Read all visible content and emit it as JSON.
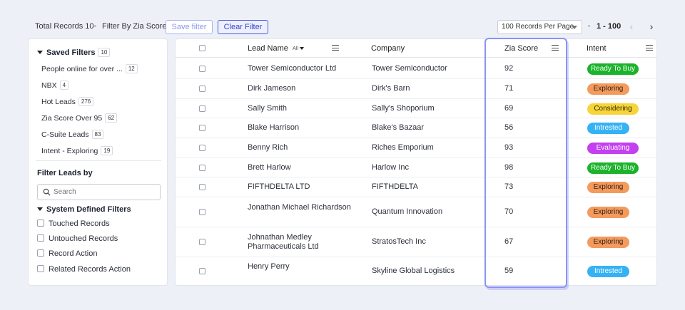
{
  "toolbar": {
    "total_records": "Total Records 10",
    "filter_by": "Filter By Zia Score",
    "save_filter": "Save filter",
    "clear_filter": "Clear Filter",
    "per_page": "100 Records Per Page",
    "page_range": "1 - 100",
    "prev_glyph": "‹",
    "next_glyph": "›"
  },
  "sidebar": {
    "saved_filters": {
      "label": "Saved Filters",
      "count": "10"
    },
    "saved_items": [
      {
        "label": "People online for over ...",
        "count": "12"
      },
      {
        "label": "NBX",
        "count": "4"
      },
      {
        "label": "Hot Leads",
        "count": "276"
      },
      {
        "label": "Zia Score Over 95",
        "count": "62"
      },
      {
        "label": "C-Suite Leads",
        "count": "83"
      },
      {
        "label": "Intent - Exploring",
        "count": "19"
      }
    ],
    "filter_leads_by": "Filter Leads by",
    "search_placeholder": "Search",
    "system_defined": "System Defined Filters",
    "system_items": [
      "Touched Records",
      "Untouched Records",
      "Record Action",
      "Related Records Action"
    ]
  },
  "table": {
    "headers": {
      "lead_name": "Lead Name",
      "all_tag": "All",
      "company": "Company",
      "zia_score": "Zia Score",
      "intent": "Intent"
    },
    "rows": [
      {
        "lead": "Tower Semiconductor Ltd",
        "company": "Tower Semiconductor",
        "score": "92",
        "intent": "Ready To Buy"
      },
      {
        "lead": "Dirk Jameson",
        "company": "Dirk's Barn",
        "score": "71",
        "intent": "Exploring"
      },
      {
        "lead": "Sally Smith",
        "company": "Sally's Shoporium",
        "score": "69",
        "intent": "Considering"
      },
      {
        "lead": "Blake Harrison",
        "company": "Blake's Bazaar",
        "score": "56",
        "intent": "Intrested"
      },
      {
        "lead": "Benny Rich",
        "company": "Riches Emporium",
        "score": "93",
        "intent": "Evaluating"
      },
      {
        "lead": "Brett Harlow",
        "company": "Harlow Inc",
        "score": "98",
        "intent": "Ready To Buy"
      },
      {
        "lead": "FIFTHDELTA LTD",
        "company": "FIFTHDELTA",
        "score": "73",
        "intent": "Exploring"
      },
      {
        "lead": "Jonathan Michael Richardson",
        "company": "Quantum Innovation",
        "score": "70",
        "intent": "Exploring"
      },
      {
        "lead": "Johnathan Medley Pharmaceuticals Ltd",
        "company": "StratosTech Inc",
        "score": "67",
        "intent": "Exploring"
      },
      {
        "lead": "Henry Perry",
        "company": "Skyline Global Logistics",
        "score": "59",
        "intent": "Intrested"
      }
    ]
  },
  "intent_colors": {
    "Ready To Buy": {
      "bg": "#1bb32a",
      "fg": "#ffffff"
    },
    "Exploring": {
      "bg": "#f39a5d",
      "fg": "#3a2212"
    },
    "Considering": {
      "bg": "#f6d43a",
      "fg": "#3a3000"
    },
    "Intrested": {
      "bg": "#35b2f4",
      "fg": "#ffffff"
    },
    "Evaluating": {
      "bg": "#c33ff0",
      "fg": "#ffffff"
    }
  },
  "highlight_color": "#8a93f2"
}
